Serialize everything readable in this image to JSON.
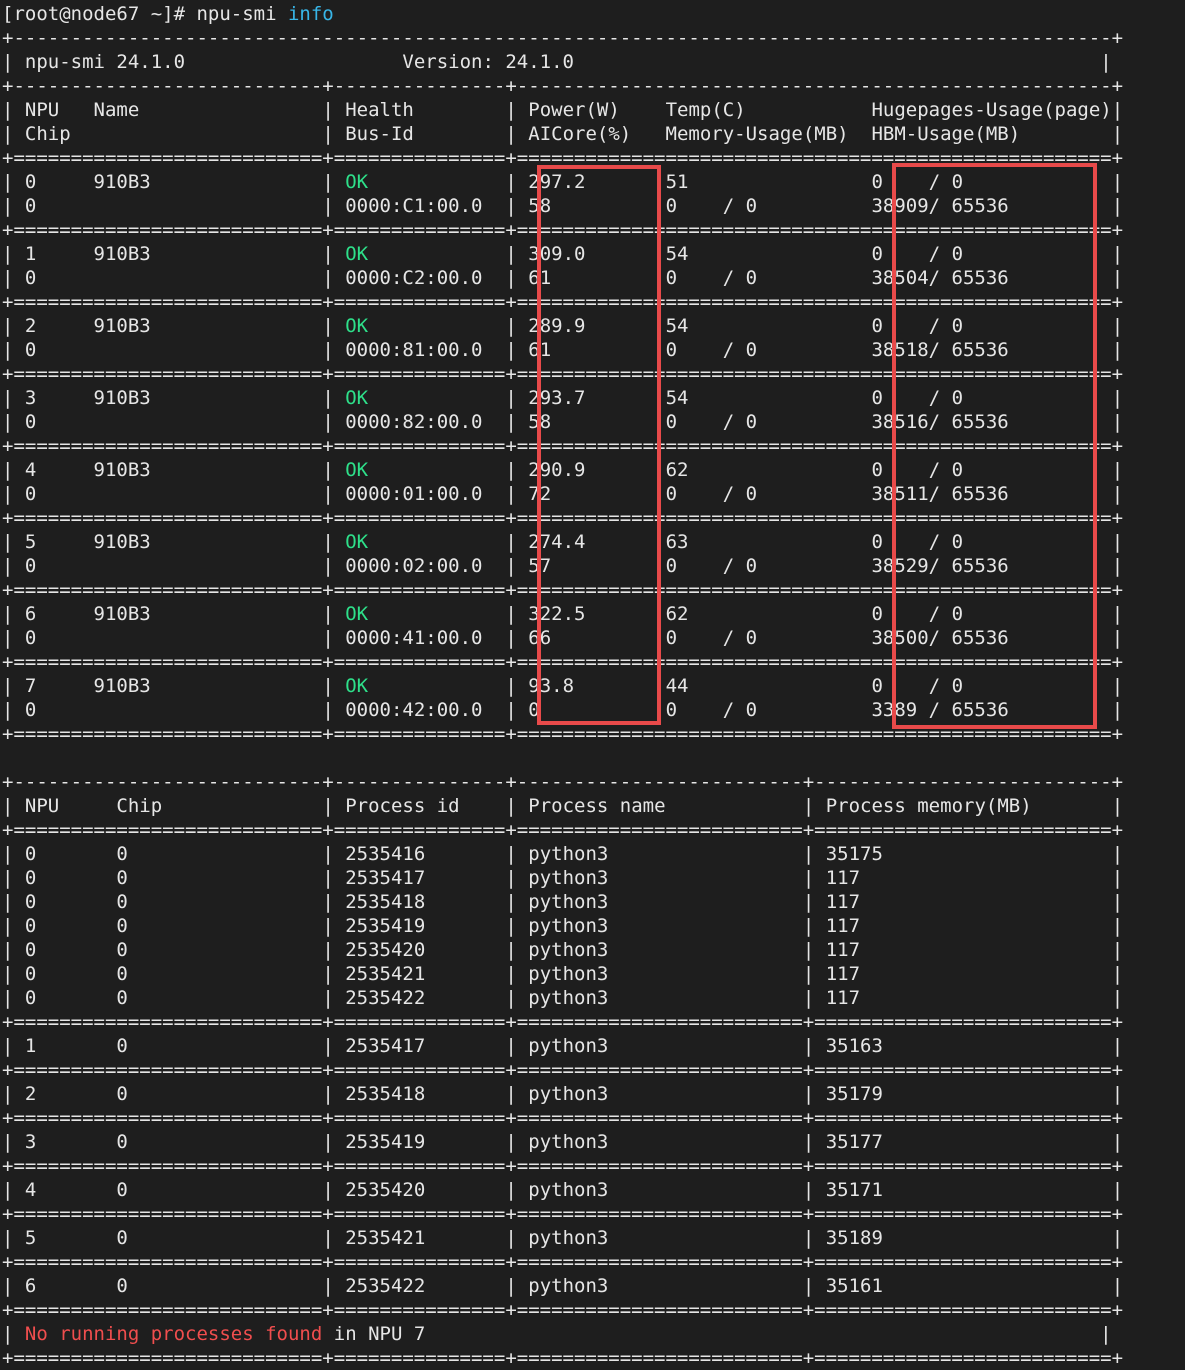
{
  "colors": {
    "background": "#1e1e1e",
    "text": "#e6e6e6",
    "command_arg": "#38b6e8",
    "health_ok": "#2ee08a",
    "warning": "#f04e4e",
    "highlight_box": "#e84a4a"
  },
  "prompt": {
    "text": "[root@node67 ~]# npu-smi ",
    "arg": "info"
  },
  "header": {
    "left": "npu-smi 24.1.0",
    "version_label": "Version: 24.1.0"
  },
  "device_columns": {
    "row1": [
      "NPU",
      "Name",
      "Health",
      "Power(W)",
      "Temp(C)",
      "Hugepages-Usage(page)"
    ],
    "row2": [
      "Chip",
      "Bus-Id",
      "AICore(%)",
      "Memory-Usage(MB)",
      "HBM-Usage(MB)"
    ]
  },
  "devices": [
    {
      "npu": "0",
      "name": "910B3",
      "health": "OK",
      "power": "297.2",
      "temp": "51",
      "hugepages": "0    / 0",
      "chip": "0",
      "bus_id": "0000:C1:00.0",
      "aicore": "58",
      "memory": "0    / 0",
      "hbm": "38909/ 65536"
    },
    {
      "npu": "1",
      "name": "910B3",
      "health": "OK",
      "power": "309.0",
      "temp": "54",
      "hugepages": "0    / 0",
      "chip": "0",
      "bus_id": "0000:C2:00.0",
      "aicore": "61",
      "memory": "0    / 0",
      "hbm": "38504/ 65536"
    },
    {
      "npu": "2",
      "name": "910B3",
      "health": "OK",
      "power": "289.9",
      "temp": "54",
      "hugepages": "0    / 0",
      "chip": "0",
      "bus_id": "0000:81:00.0",
      "aicore": "61",
      "memory": "0    / 0",
      "hbm": "38518/ 65536"
    },
    {
      "npu": "3",
      "name": "910B3",
      "health": "OK",
      "power": "293.7",
      "temp": "54",
      "hugepages": "0    / 0",
      "chip": "0",
      "bus_id": "0000:82:00.0",
      "aicore": "58",
      "memory": "0    / 0",
      "hbm": "38516/ 65536"
    },
    {
      "npu": "4",
      "name": "910B3",
      "health": "OK",
      "power": "290.9",
      "temp": "62",
      "hugepages": "0    / 0",
      "chip": "0",
      "bus_id": "0000:01:00.0",
      "aicore": "72",
      "memory": "0    / 0",
      "hbm": "38511/ 65536"
    },
    {
      "npu": "5",
      "name": "910B3",
      "health": "OK",
      "power": "274.4",
      "temp": "63",
      "hugepages": "0    / 0",
      "chip": "0",
      "bus_id": "0000:02:00.0",
      "aicore": "57",
      "memory": "0    / 0",
      "hbm": "38529/ 65536"
    },
    {
      "npu": "6",
      "name": "910B3",
      "health": "OK",
      "power": "322.5",
      "temp": "62",
      "hugepages": "0    / 0",
      "chip": "0",
      "bus_id": "0000:41:00.0",
      "aicore": "66",
      "memory": "0    / 0",
      "hbm": "38500/ 65536"
    },
    {
      "npu": "7",
      "name": "910B3",
      "health": "OK",
      "power": "93.8",
      "temp": "44",
      "hugepages": "0    / 0",
      "chip": "0",
      "bus_id": "0000:42:00.0",
      "aicore": "0",
      "memory": "0    / 0",
      "hbm": "3389 / 65536"
    }
  ],
  "process_columns": [
    "NPU",
    "Chip",
    "Process id",
    "Process name",
    "Process memory(MB)"
  ],
  "process_groups": [
    {
      "rows": [
        {
          "npu": "0",
          "chip": "0",
          "pid": "2535416",
          "name": "python3",
          "mem": "35175"
        },
        {
          "npu": "0",
          "chip": "0",
          "pid": "2535417",
          "name": "python3",
          "mem": "117"
        },
        {
          "npu": "0",
          "chip": "0",
          "pid": "2535418",
          "name": "python3",
          "mem": "117"
        },
        {
          "npu": "0",
          "chip": "0",
          "pid": "2535419",
          "name": "python3",
          "mem": "117"
        },
        {
          "npu": "0",
          "chip": "0",
          "pid": "2535420",
          "name": "python3",
          "mem": "117"
        },
        {
          "npu": "0",
          "chip": "0",
          "pid": "2535421",
          "name": "python3",
          "mem": "117"
        },
        {
          "npu": "0",
          "chip": "0",
          "pid": "2535422",
          "name": "python3",
          "mem": "117"
        }
      ]
    },
    {
      "rows": [
        {
          "npu": "1",
          "chip": "0",
          "pid": "2535417",
          "name": "python3",
          "mem": "35163"
        }
      ]
    },
    {
      "rows": [
        {
          "npu": "2",
          "chip": "0",
          "pid": "2535418",
          "name": "python3",
          "mem": "35179"
        }
      ]
    },
    {
      "rows": [
        {
          "npu": "3",
          "chip": "0",
          "pid": "2535419",
          "name": "python3",
          "mem": "35177"
        }
      ]
    },
    {
      "rows": [
        {
          "npu": "4",
          "chip": "0",
          "pid": "2535420",
          "name": "python3",
          "mem": "35171"
        }
      ]
    },
    {
      "rows": [
        {
          "npu": "5",
          "chip": "0",
          "pid": "2535421",
          "name": "python3",
          "mem": "35189"
        }
      ]
    },
    {
      "rows": [
        {
          "npu": "6",
          "chip": "0",
          "pid": "2535422",
          "name": "python3",
          "mem": "35161"
        }
      ]
    }
  ],
  "no_process": {
    "message": "No running processes found",
    "suffix": " in NPU 7"
  }
}
